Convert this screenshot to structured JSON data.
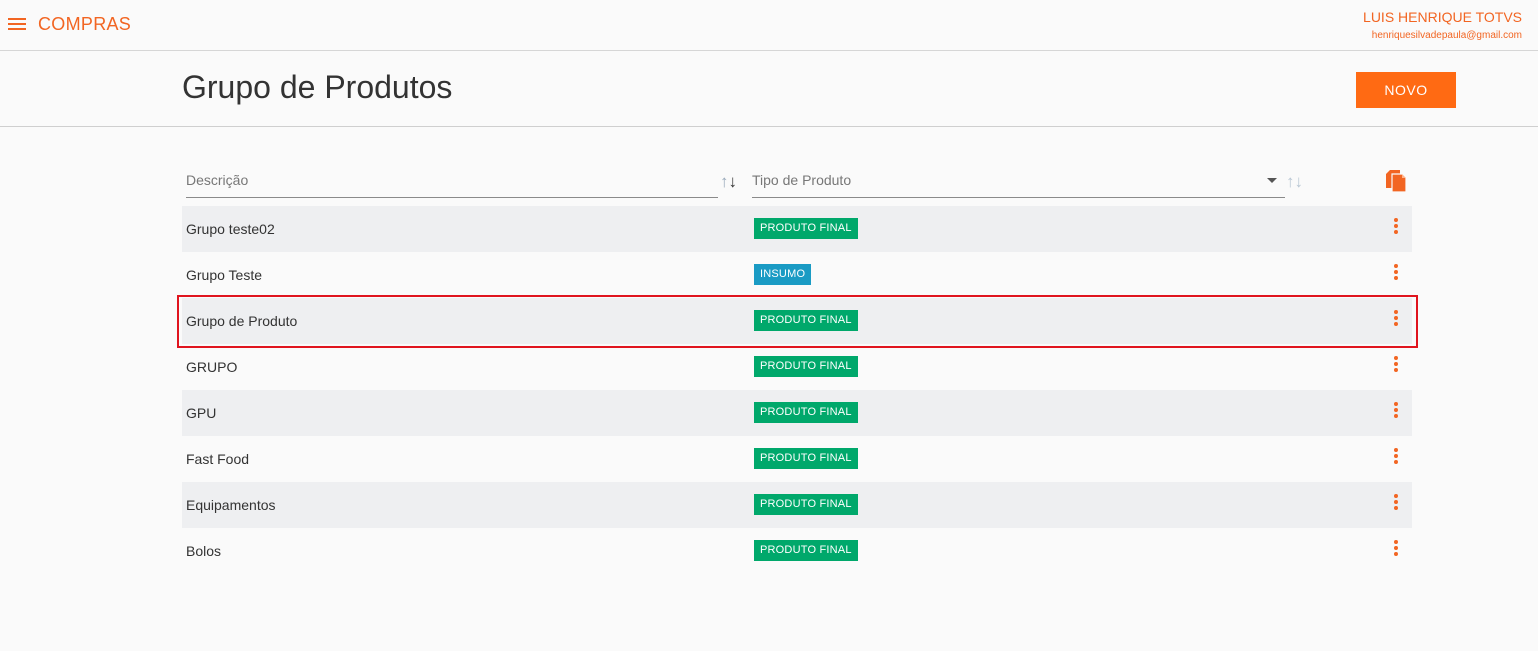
{
  "app": {
    "title": "COMPRAS"
  },
  "user": {
    "name": "LUIS HENRIQUE TOTVS",
    "email": "henriquesilvadepaula@gmail.com"
  },
  "page": {
    "title": "Grupo de Produtos",
    "new_button": "NOVO"
  },
  "filters": {
    "descricao_placeholder": "Descrição",
    "tipo_placeholder": "Tipo de Produto"
  },
  "colors": {
    "accent": "#f26522",
    "produto_final": "#00a86b",
    "insumo": "#1a9bc4",
    "highlight": "#e0141e"
  },
  "rows": [
    {
      "descricao": "Grupo teste02",
      "tipo": "PRODUTO FINAL"
    },
    {
      "descricao": "Grupo Teste",
      "tipo": "INSUMO"
    },
    {
      "descricao": "Grupo de Produto",
      "tipo": "PRODUTO FINAL"
    },
    {
      "descricao": "GRUPO",
      "tipo": "PRODUTO FINAL"
    },
    {
      "descricao": "GPU",
      "tipo": "PRODUTO FINAL"
    },
    {
      "descricao": "Fast Food",
      "tipo": "PRODUTO FINAL"
    },
    {
      "descricao": "Equipamentos",
      "tipo": "PRODUTO FINAL"
    },
    {
      "descricao": "Bolos",
      "tipo": "PRODUTO FINAL"
    }
  ]
}
